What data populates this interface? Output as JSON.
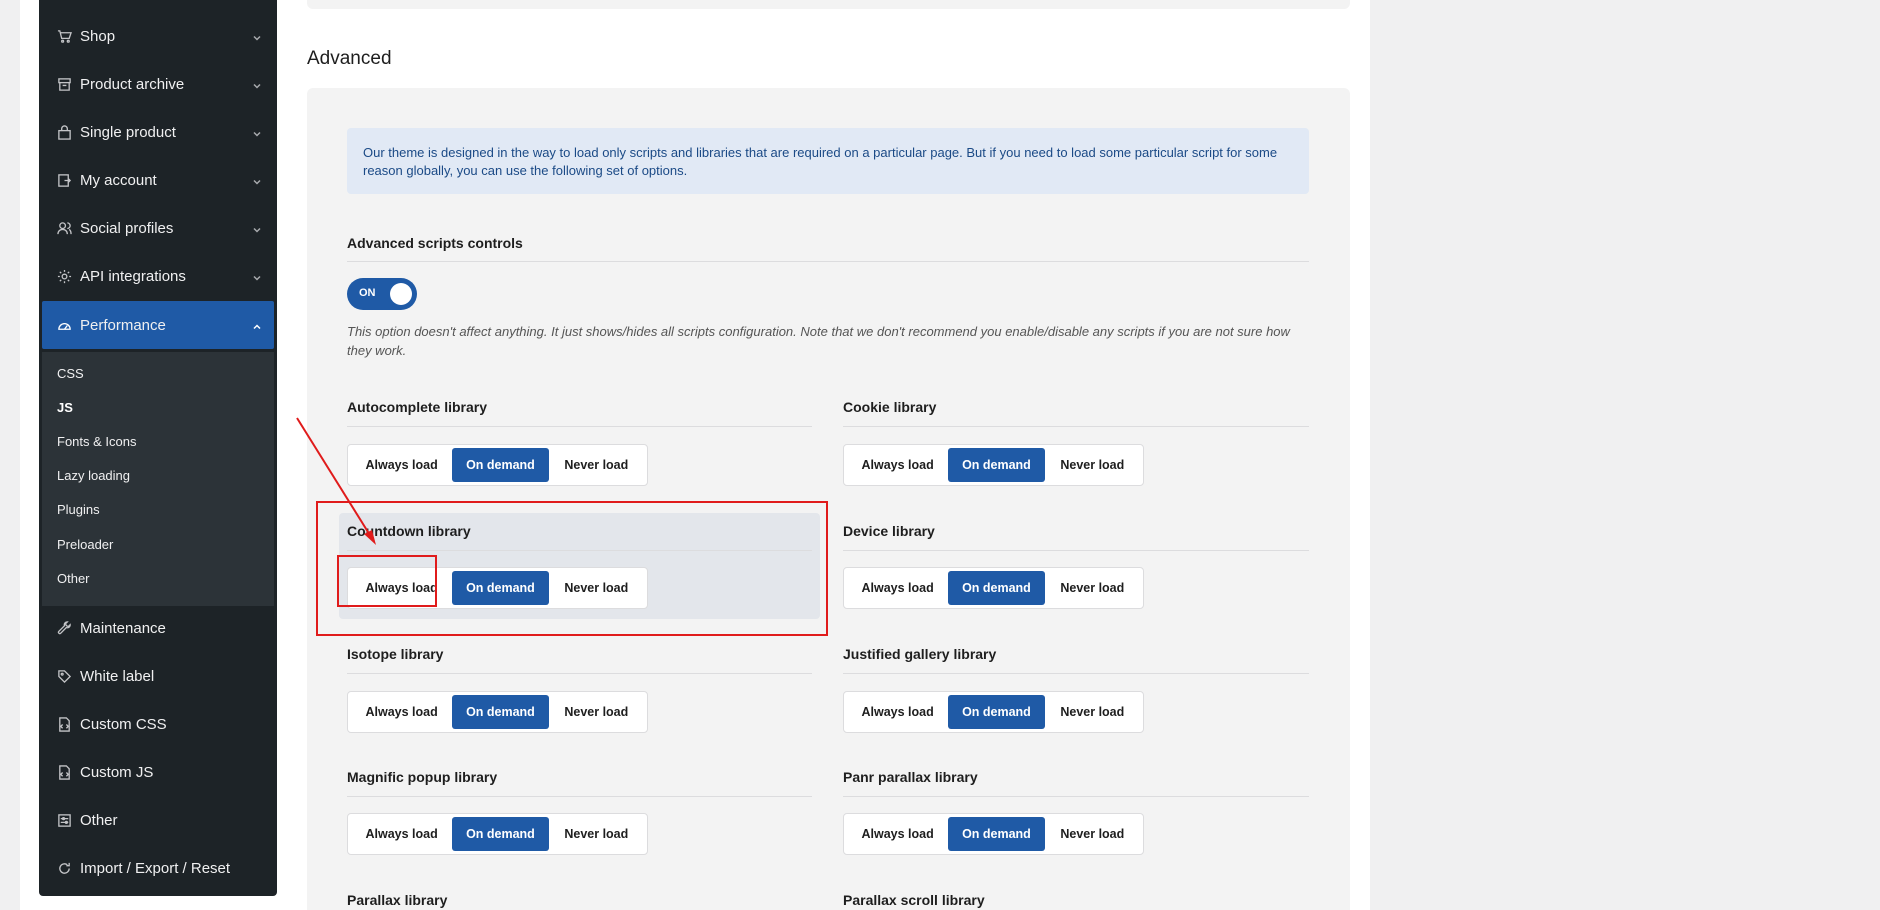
{
  "sidebar": {
    "items": [
      {
        "label": "Shop",
        "icon": "cart-icon",
        "expanded": false
      },
      {
        "label": "Product archive",
        "icon": "archive-icon",
        "expanded": false
      },
      {
        "label": "Single product",
        "icon": "bag-icon",
        "expanded": false
      },
      {
        "label": "My account",
        "icon": "account-icon",
        "expanded": false
      },
      {
        "label": "Social profiles",
        "icon": "users-icon",
        "expanded": false
      },
      {
        "label": "API integrations",
        "icon": "gear-icon",
        "expanded": false
      },
      {
        "label": "Performance",
        "icon": "gauge-icon",
        "expanded": true,
        "active": true
      },
      {
        "label": "Maintenance",
        "icon": "wrench-icon"
      },
      {
        "label": "White label",
        "icon": "tag-icon"
      },
      {
        "label": "Custom CSS",
        "icon": "code-file-icon"
      },
      {
        "label": "Custom JS",
        "icon": "code-file-icon"
      },
      {
        "label": "Other",
        "icon": "sliders-icon"
      },
      {
        "label": "Import / Export / Reset",
        "icon": "refresh-icon"
      }
    ],
    "submenu": [
      "CSS",
      "JS",
      "Fonts & Icons",
      "Lazy loading",
      "Plugins",
      "Preloader",
      "Other"
    ],
    "submenu_current": "JS"
  },
  "main": {
    "section_title": "Advanced",
    "notice": "Our theme is designed in the way to load only scripts and libraries that are required on a particular page. But if you need to load some particular script for some reason globally, you can use the following set of options.",
    "advanced_controls": {
      "title": "Advanced scripts controls",
      "toggle_label": "ON",
      "toggle_on": true,
      "hint": "This option doesn't affect anything. It just shows/hides all scripts configuration. Note that we don't recommend you enable/disable any scripts if you are not sure how they work."
    },
    "options": [
      "Always load",
      "On demand",
      "Never load"
    ],
    "libraries": [
      {
        "name": "Autocomplete library",
        "selected": "On demand"
      },
      {
        "name": "Cookie library",
        "selected": "On demand"
      },
      {
        "name": "Countdown library",
        "selected": "On demand"
      },
      {
        "name": "Device library",
        "selected": "On demand"
      },
      {
        "name": "Isotope library",
        "selected": "On demand"
      },
      {
        "name": "Justified gallery library",
        "selected": "On demand"
      },
      {
        "name": "Magnific popup library",
        "selected": "On demand"
      },
      {
        "name": "Panr parallax library",
        "selected": "On demand"
      },
      {
        "name": "Parallax library"
      },
      {
        "name": "Parallax scroll library"
      }
    ]
  },
  "colors": {
    "sidebar_bg": "#1d2327",
    "accent": "#1f5aa6",
    "annotation": "#e01b1b"
  }
}
